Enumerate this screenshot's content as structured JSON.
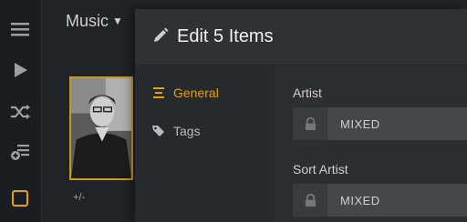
{
  "app": {
    "section_title": "Music",
    "section_caret": "▼"
  },
  "sidebar": {
    "icons": [
      "menu-icon",
      "play-icon",
      "shuffle-icon",
      "add-to-playlist-icon",
      "select-checkbox-icon"
    ]
  },
  "library": {
    "rating_text": "+/-"
  },
  "modal": {
    "title": "Edit 5 Items",
    "nav": [
      {
        "label": "General",
        "active": true
      },
      {
        "label": "Tags",
        "active": false
      }
    ],
    "fields": [
      {
        "label": "Artist",
        "value": "MIXED"
      },
      {
        "label": "Sort Artist",
        "value": "MIXED"
      }
    ]
  },
  "colors": {
    "accent": "#e5a00d",
    "background": "#202327",
    "modal": "#2b2e33"
  }
}
